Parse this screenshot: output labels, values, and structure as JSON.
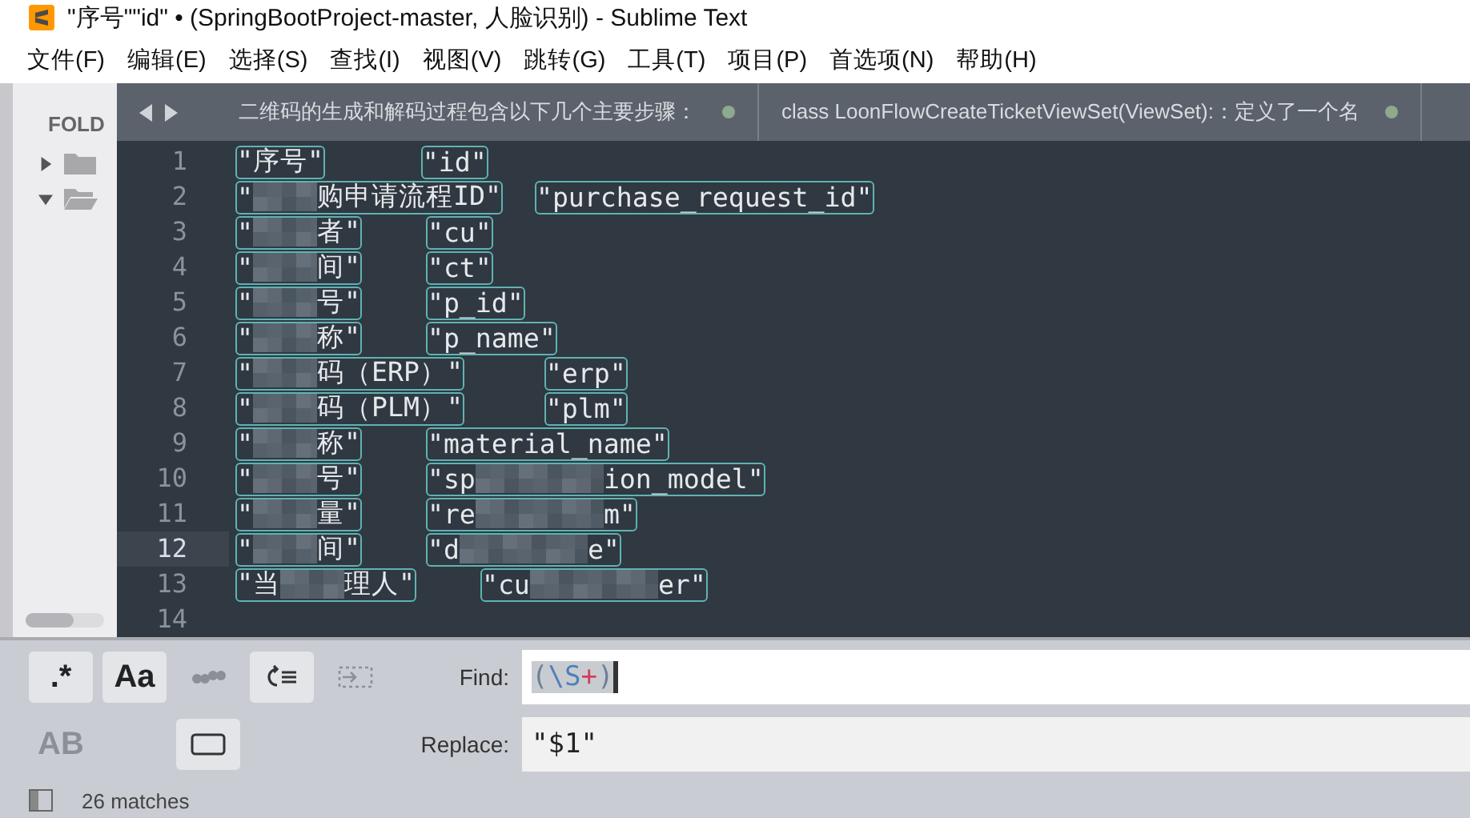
{
  "window": {
    "title": "\"序号\"\"id\" • (SpringBootProject-master, 人脸识别) - Sublime Text"
  },
  "menu": [
    "文件(F)",
    "编辑(E)",
    "选择(S)",
    "查找(I)",
    "视图(V)",
    "跳转(G)",
    "工具(T)",
    "项目(P)",
    "首选项(N)",
    "帮助(H)"
  ],
  "sidebar": {
    "header": "FOLD",
    "folders": [
      {
        "expanded": false
      },
      {
        "expanded": true
      }
    ]
  },
  "tabs": [
    {
      "label": "二维码的生成和解码过程包含以下几个主要步骤：",
      "selected": false,
      "dirty": true
    },
    {
      "label": "class LoonFlowCreateTicketViewSet(ViewSet):：定义了一个名",
      "selected": false,
      "dirty": true
    }
  ],
  "editor": {
    "lines": [
      {
        "number": "1",
        "left": [
          "\"序号\""
        ],
        "right": [
          "\"id\""
        ],
        "current": false
      },
      {
        "number": "2",
        "left": [
          "\"",
          "购申请流程ID\""
        ],
        "right": [
          "\"purchase_request_id\""
        ],
        "current": false
      },
      {
        "number": "3",
        "left": [
          "\"",
          "者\""
        ],
        "right": [
          "\"cu\""
        ],
        "current": false
      },
      {
        "number": "4",
        "left": [
          "\"",
          "间\""
        ],
        "right": [
          "\"ct\""
        ],
        "current": false
      },
      {
        "number": "5",
        "left": [
          "\"",
          "号\""
        ],
        "right": [
          "\"p_id\""
        ],
        "current": false
      },
      {
        "number": "6",
        "left": [
          "\"",
          "称\""
        ],
        "right": [
          "\"p_name\""
        ],
        "current": false
      },
      {
        "number": "7",
        "left": [
          "\"",
          "码（ERP）\""
        ],
        "right": [
          "\"erp\""
        ],
        "current": false
      },
      {
        "number": "8",
        "left": [
          "\"",
          "码（PLM）\""
        ],
        "right": [
          "\"plm\""
        ],
        "current": false
      },
      {
        "number": "9",
        "left": [
          "\"",
          "称\""
        ],
        "right": [
          "\"material_name\""
        ],
        "current": false
      },
      {
        "number": "10",
        "left": [
          "\"",
          "号\""
        ],
        "right": [
          "\"sp",
          "ion_model\""
        ],
        "current": false
      },
      {
        "number": "11",
        "left": [
          "\"",
          "量\""
        ],
        "right": [
          "\"re",
          "m\""
        ],
        "current": false
      },
      {
        "number": "12",
        "left": [
          "\"",
          "间\""
        ],
        "right": [
          "\"d",
          "e\""
        ],
        "current": true
      },
      {
        "number": "13",
        "left": [
          "\"当",
          "理人\""
        ],
        "right": [
          "\"cu",
          "er\""
        ],
        "current": false
      },
      {
        "number": "14"
      }
    ]
  },
  "find_panel": {
    "toggles": [
      {
        "kind": "text",
        "label": ".*",
        "selected": true
      },
      {
        "kind": "text",
        "label": "Aa",
        "selected": true
      },
      {
        "kind": "quotes",
        "selected": false
      },
      {
        "kind": "wrap",
        "selected": true
      },
      {
        "kind": "selection",
        "selected": false
      },
      {
        "kind": "text",
        "label": "AB",
        "selected": false
      },
      {
        "kind": "blank"
      },
      {
        "kind": "frame",
        "selected": true
      }
    ],
    "find_label": "Find:",
    "find_value": [
      {
        "kind": "group",
        "text": "("
      },
      {
        "kind": "escape",
        "text": "\\S"
      },
      {
        "kind": "quantifier",
        "text": "+"
      },
      {
        "kind": "group",
        "text": ")"
      }
    ],
    "replace_label": "Replace:",
    "replace_value": "\"$1\""
  },
  "status_bar": {
    "matches": "26 matches"
  }
}
